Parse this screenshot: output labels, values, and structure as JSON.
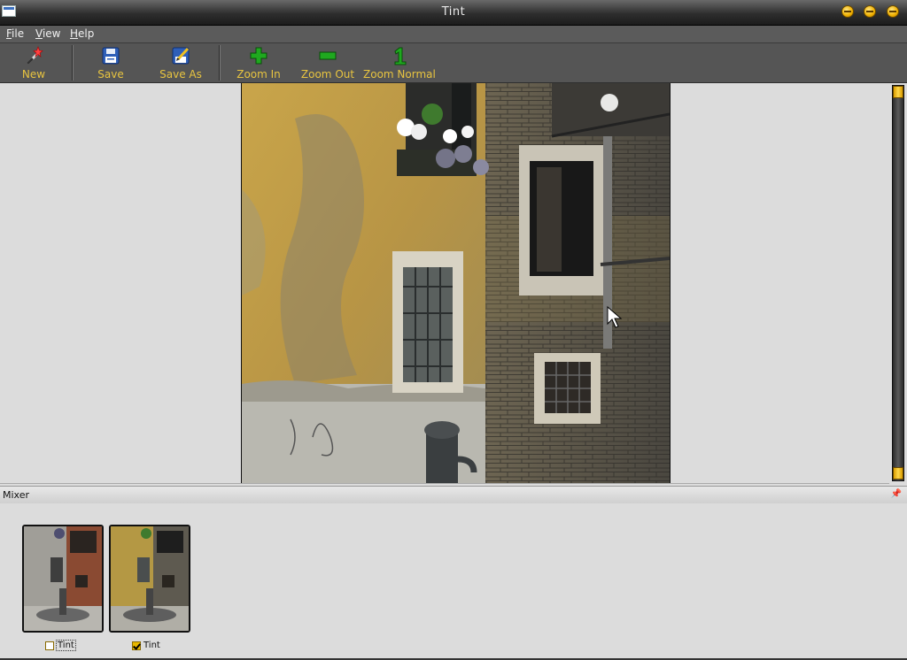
{
  "window": {
    "title": "Tint",
    "controls": [
      "minimize-icon",
      "maximize-icon",
      "close-icon"
    ]
  },
  "menubar": {
    "items": [
      {
        "label": "File",
        "mnemonic": "F",
        "rest": "ile"
      },
      {
        "label": "View",
        "mnemonic": "V",
        "rest": "iew"
      },
      {
        "label": "Help",
        "mnemonic": "H",
        "rest": "elp"
      }
    ]
  },
  "toolbar": {
    "label_color": "#e8c440",
    "buttons": [
      {
        "label": "New",
        "icon": "magic-wand-icon"
      },
      {
        "label": "Save",
        "icon": "floppy-disk-icon"
      },
      {
        "label": "Save As",
        "icon": "save-as-icon"
      },
      {
        "label": "Zoom In",
        "icon": "plus-icon"
      },
      {
        "label": "Zoom Out",
        "icon": "minus-icon"
      },
      {
        "label": "Zoom Normal",
        "icon": "one-icon"
      }
    ]
  },
  "canvas": {
    "background": "#dcdcdc",
    "image_description": "photo of weathered yellow and brick building walls with windows, flower box and water fountain"
  },
  "mixer": {
    "title": "Mixer",
    "thumbnails": [
      {
        "label": "Tint",
        "checked": false,
        "focused": true,
        "variant": "red-brick"
      },
      {
        "label": "Tint",
        "checked": true,
        "focused": false,
        "variant": "yellow-wall"
      }
    ]
  },
  "colors": {
    "accent": "#f0b000",
    "toolbar_bg": "#555555",
    "menubar_bg": "#5b5b5b"
  }
}
